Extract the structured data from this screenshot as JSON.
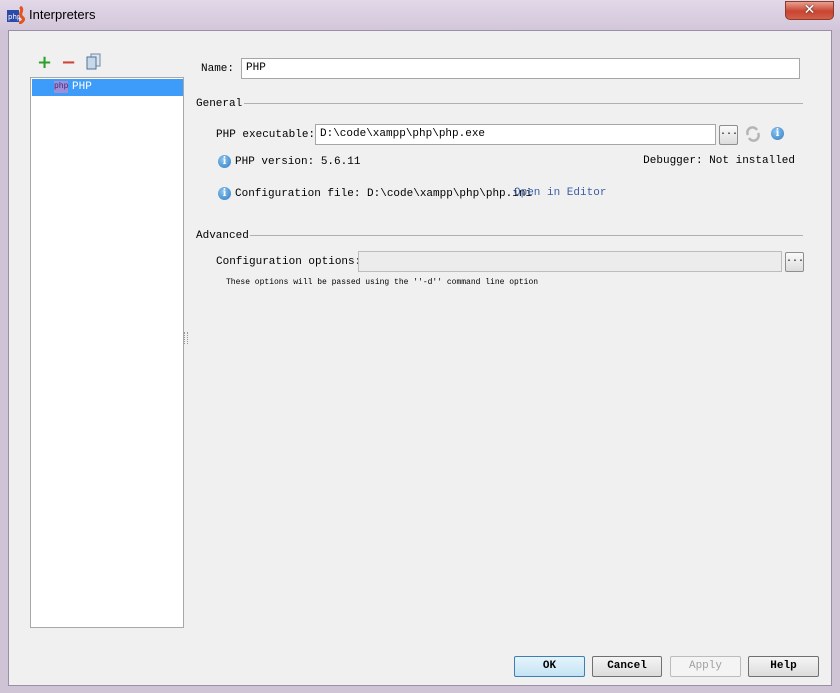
{
  "window": {
    "title": "Interpreters",
    "close_glyph": "✕"
  },
  "toolbar": {
    "add": "+",
    "remove": "−"
  },
  "list": {
    "items": [
      {
        "label": "PHP",
        "icon_text": "php"
      }
    ]
  },
  "form": {
    "name_label": "Name:",
    "name_value": "PHP",
    "general_heading": "General",
    "executable_label": "PHP executable:",
    "executable_value": "D:\\code\\xampp\\php\\php.exe",
    "browse_label": "...",
    "version_text": "PHP version: 5.6.11",
    "debugger_text": "Debugger: Not installed",
    "config_file_text": "Configuration file: D:\\code\\xampp\\php\\php.ini",
    "open_in_editor": "Open in Editor",
    "advanced_heading": "Advanced",
    "config_options_label": "Configuration options:",
    "config_options_value": "",
    "hint": "These options will be passed using the ''-d'' command line option",
    "info_glyph": "i"
  },
  "buttons": {
    "ok": "OK",
    "cancel": "Cancel",
    "apply": "Apply",
    "help": "Help"
  }
}
